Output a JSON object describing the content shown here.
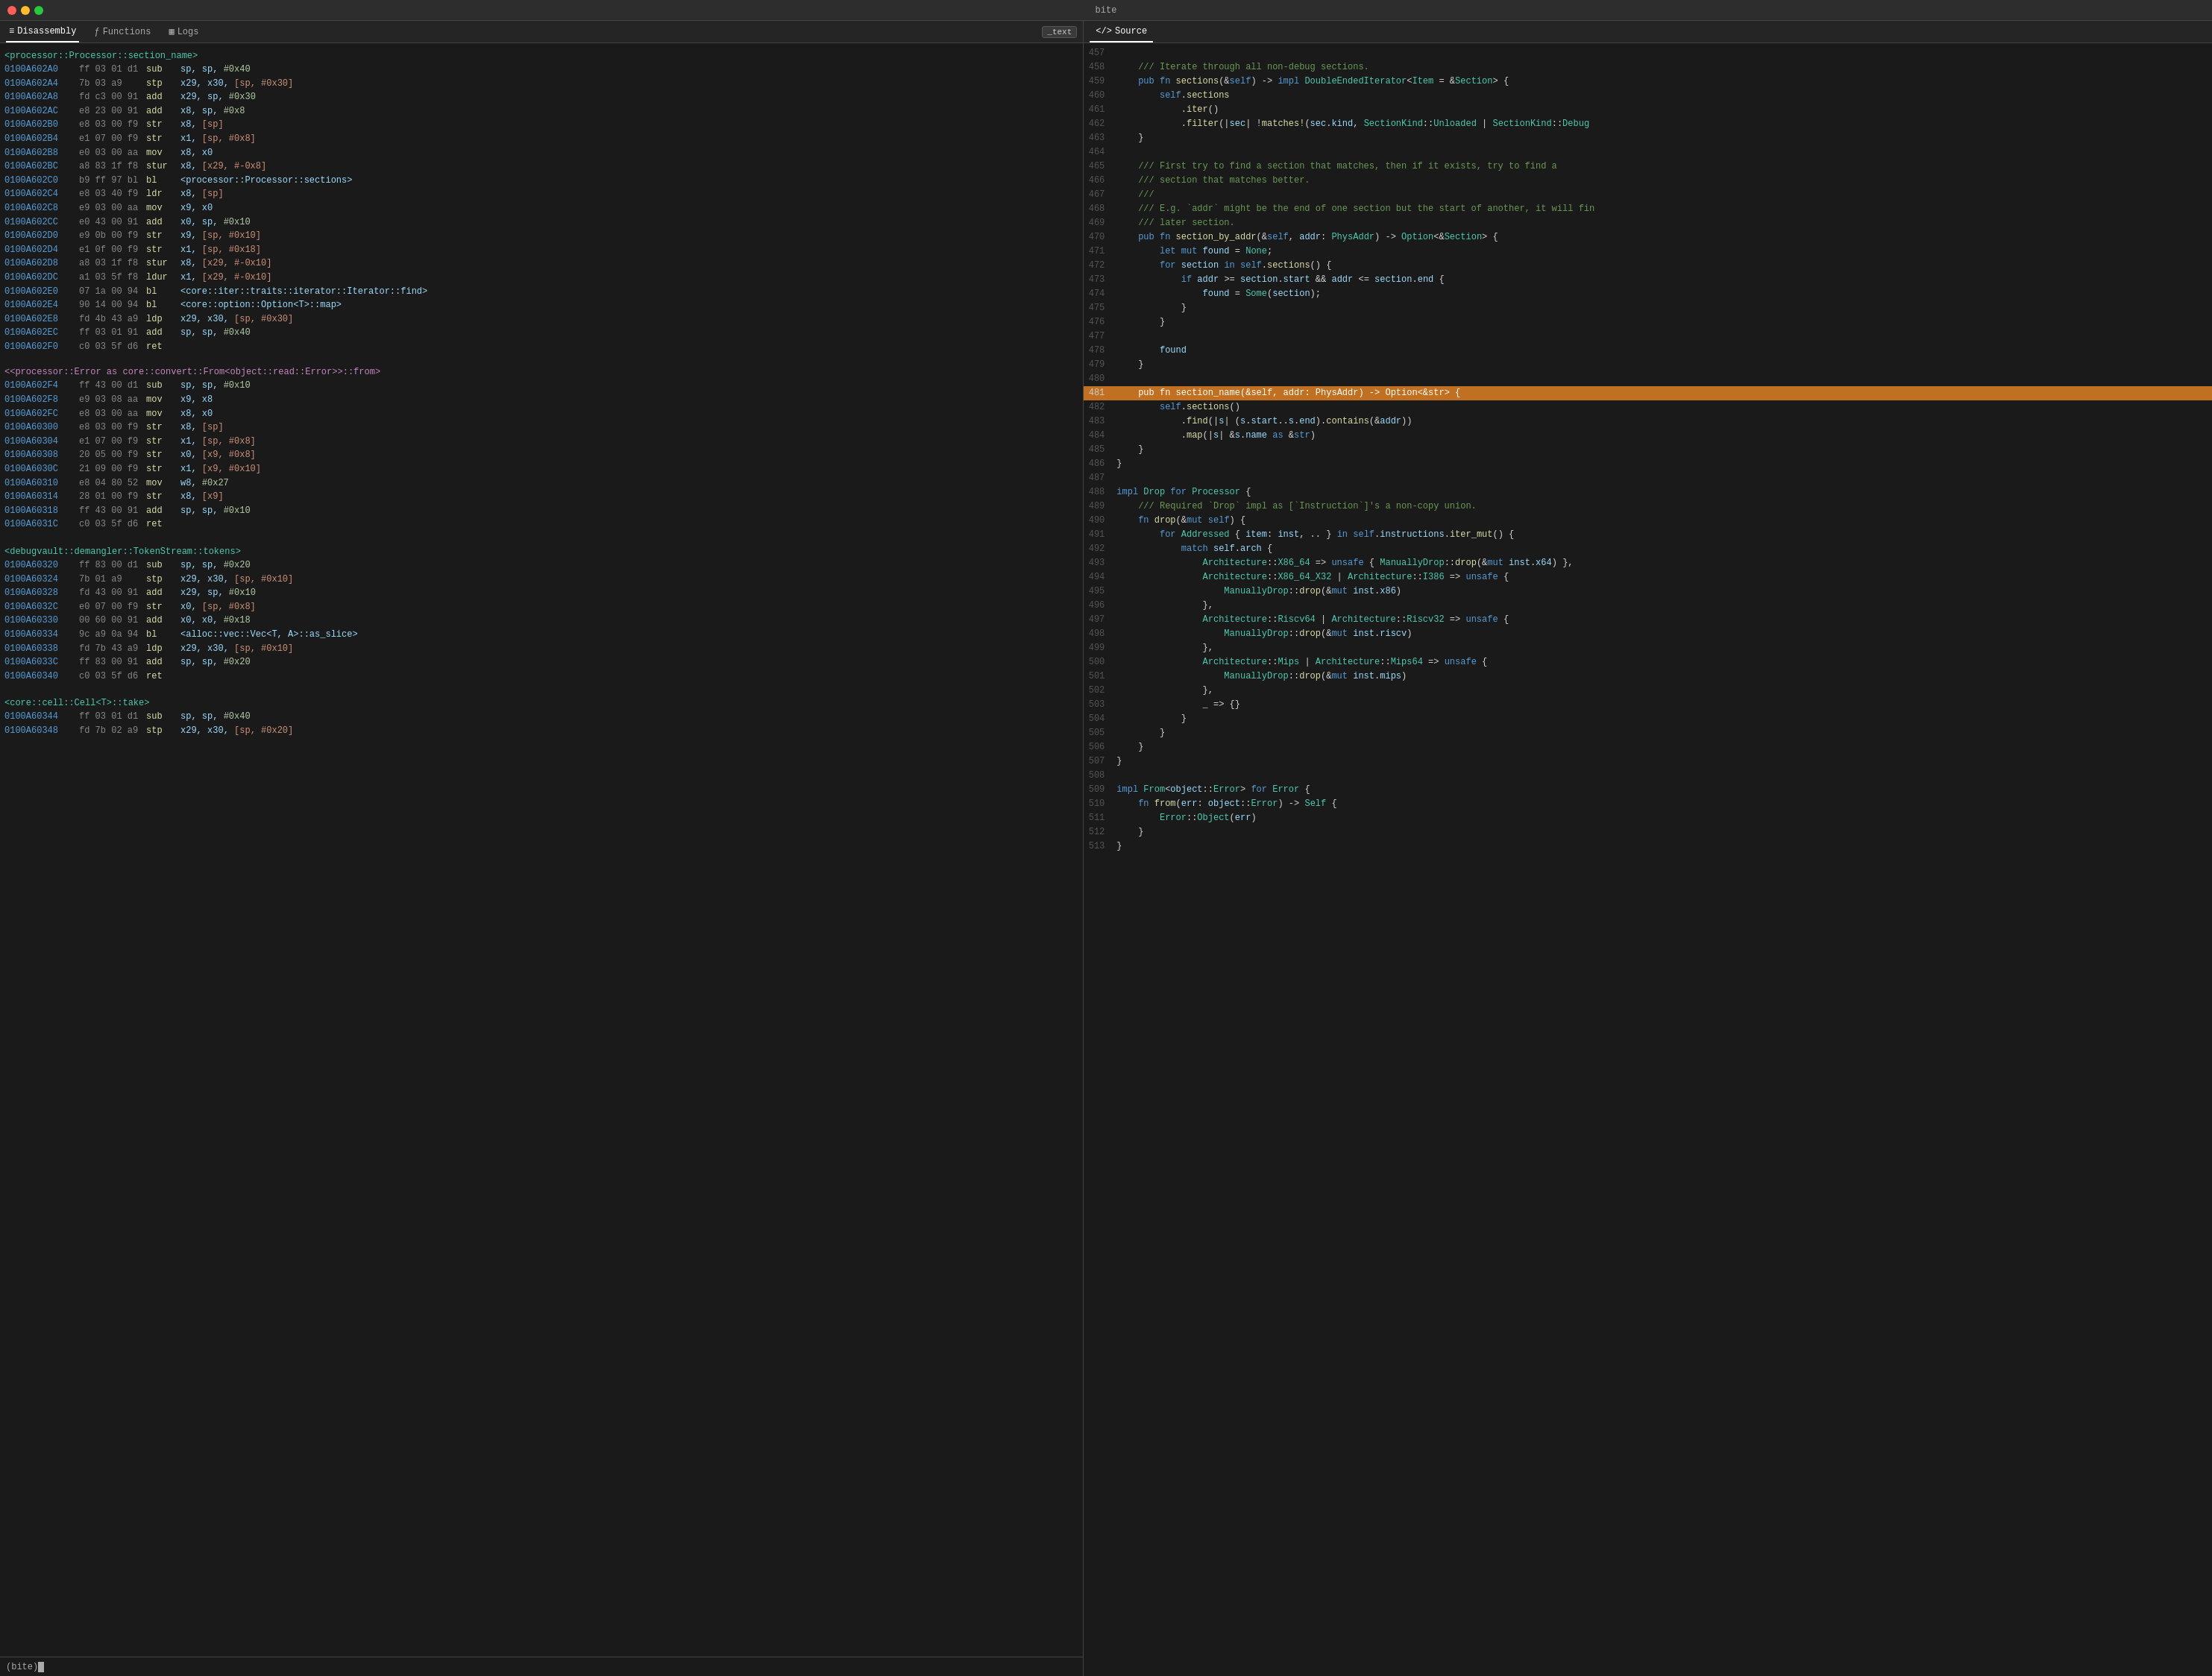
{
  "titleBar": {
    "title": "bite"
  },
  "leftPane": {
    "tabs": [
      {
        "id": "disassembly",
        "label": "Disassembly",
        "icon": "≡",
        "active": true
      },
      {
        "id": "functions",
        "label": "Functions",
        "icon": "ƒ",
        "active": false
      },
      {
        "id": "logs",
        "label": "Logs",
        "icon": "▦",
        "active": false
      }
    ],
    "sectionBadgeLabel": "_text",
    "rows": []
  },
  "rightPane": {
    "tabs": [
      {
        "id": "source",
        "label": "Source",
        "icon": "</>",
        "active": true
      }
    ]
  },
  "terminal": {
    "prompt": "(bite) "
  }
}
